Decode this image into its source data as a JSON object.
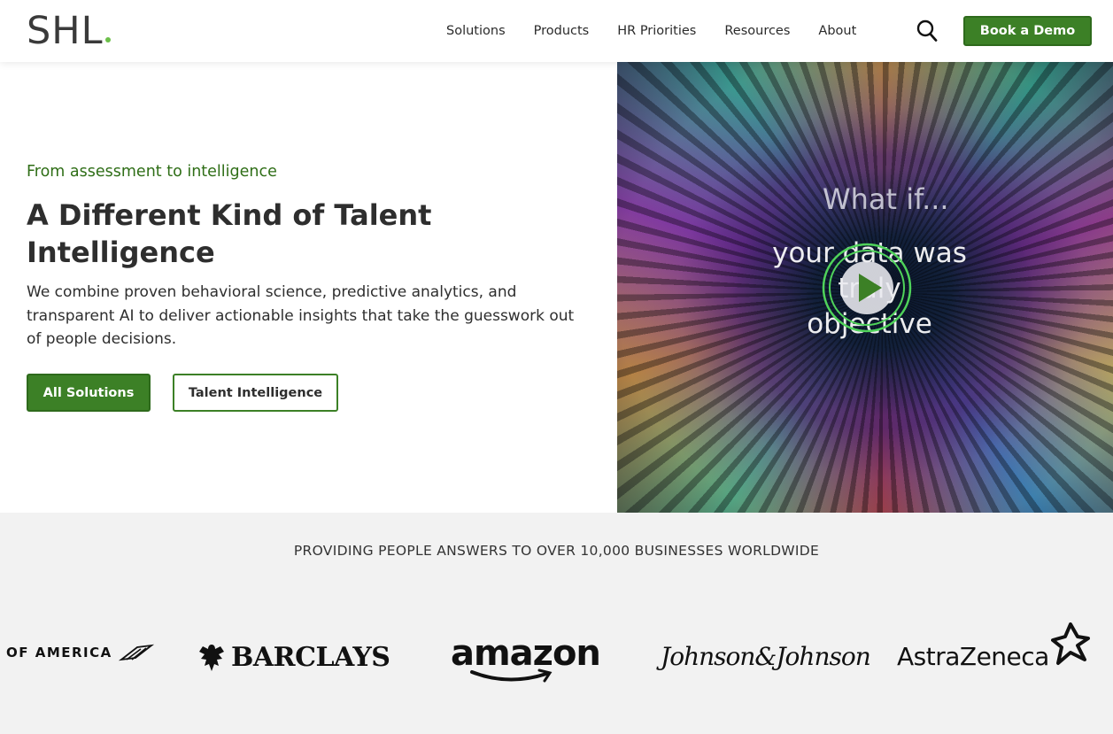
{
  "header": {
    "logo_text": "SHL",
    "nav": [
      "Solutions",
      "Products",
      "HR Priorities",
      "Resources",
      "About"
    ],
    "demo_label": "Book a Demo"
  },
  "hero": {
    "eyebrow": "From assessment to intelligence",
    "title": "A Different Kind of Talent Intelligence",
    "description": "We combine proven behavioral science, predictive analytics, and transparent AI to deliver actionable insights that take the guesswork out of people decisions.",
    "primary_label": "All Solutions",
    "secondary_label": "Talent Intelligence"
  },
  "video": {
    "line1": "What if...",
    "line2": "your data was truly objective"
  },
  "clients": {
    "title": "PROVIDING PEOPLE ANSWERS TO OVER 10,000 BUSINESSES WORLDWIDE",
    "logos": [
      "OF AMERICA",
      "BARCLAYS",
      "amazon",
      "Johnson&Johnson",
      "AstraZeneca"
    ]
  },
  "colors": {
    "brand_green": "#3c8026",
    "eyebrow_green": "#2f6e17",
    "logo_dot": "#6cc04a",
    "band_bg": "#f2f2f2"
  }
}
